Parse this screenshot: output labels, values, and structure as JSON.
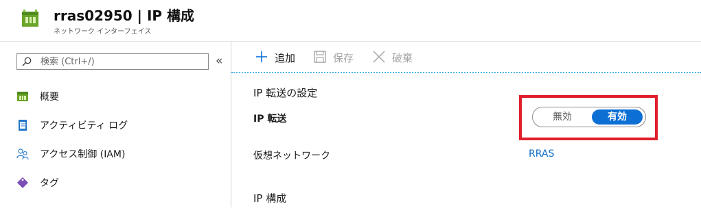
{
  "header": {
    "title": "rras02950 | IP 構成",
    "subtitle": "ネットワーク インターフェイス",
    "icon": "network-interface-icon"
  },
  "sidebar": {
    "search": {
      "placeholder": "検索 (Ctrl+/)",
      "icon": "search-icon"
    },
    "collapse_label": "«",
    "items": [
      {
        "label": "概要",
        "icon": "overview-icon"
      },
      {
        "label": "アクティビティ ログ",
        "icon": "activity-log-icon"
      },
      {
        "label": "アクセス制御 (IAM)",
        "icon": "access-control-icon"
      },
      {
        "label": "タグ",
        "icon": "tag-icon"
      }
    ]
  },
  "toolbar": {
    "add": {
      "label": "追加",
      "icon": "plus-icon",
      "enabled": true
    },
    "save": {
      "label": "保存",
      "icon": "save-icon",
      "enabled": false
    },
    "discard": {
      "label": "破棄",
      "icon": "close-icon",
      "enabled": false
    }
  },
  "main": {
    "section_title": "IP 転送の設定",
    "ip_forwarding": {
      "label": "IP 転送",
      "options": [
        "無効",
        "有効"
      ],
      "selected": "有効"
    },
    "vnet": {
      "label": "仮想ネットワーク",
      "value": "RRAS"
    },
    "ip_config_title": "IP 構成"
  },
  "colors": {
    "accent": "#0c6fd4",
    "link": "#0b6cc7",
    "highlight_border": "#e01f2b",
    "toolbar_separator": "#4fb3e6"
  }
}
